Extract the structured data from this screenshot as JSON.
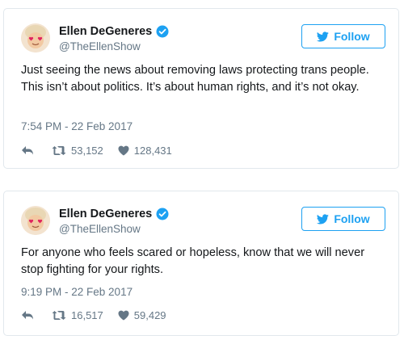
{
  "tweets": [
    {
      "display_name": "Ellen DeGeneres",
      "handle": "@TheEllenShow",
      "follow_label": "Follow",
      "text": "Just seeing the news about removing laws protecting trans people. This isn’t about politics. It’s about human rights, and it’s not okay.",
      "timestamp": "7:54 PM - 22 Feb 2017",
      "retweets": "53,152",
      "likes": "128,431"
    },
    {
      "display_name": "Ellen DeGeneres",
      "handle": "@TheEllenShow",
      "follow_label": "Follow",
      "text": "For anyone who feels scared or hopeless, know that we will never stop fighting for your rights.",
      "timestamp": "9:19 PM - 22 Feb 2017",
      "retweets": "16,517",
      "likes": "59,429"
    }
  ],
  "icons": {
    "verified": "verified-badge-icon",
    "follow": "twitter-bird-icon",
    "reply": "reply-icon",
    "retweet": "retweet-icon",
    "like": "heart-icon",
    "avatar": "heart-eyes-emoji-avatar"
  },
  "colors": {
    "brand_blue": "#1da1f2",
    "text": "#14171a",
    "secondary_text": "#657786",
    "border": "#e1e8ed"
  }
}
